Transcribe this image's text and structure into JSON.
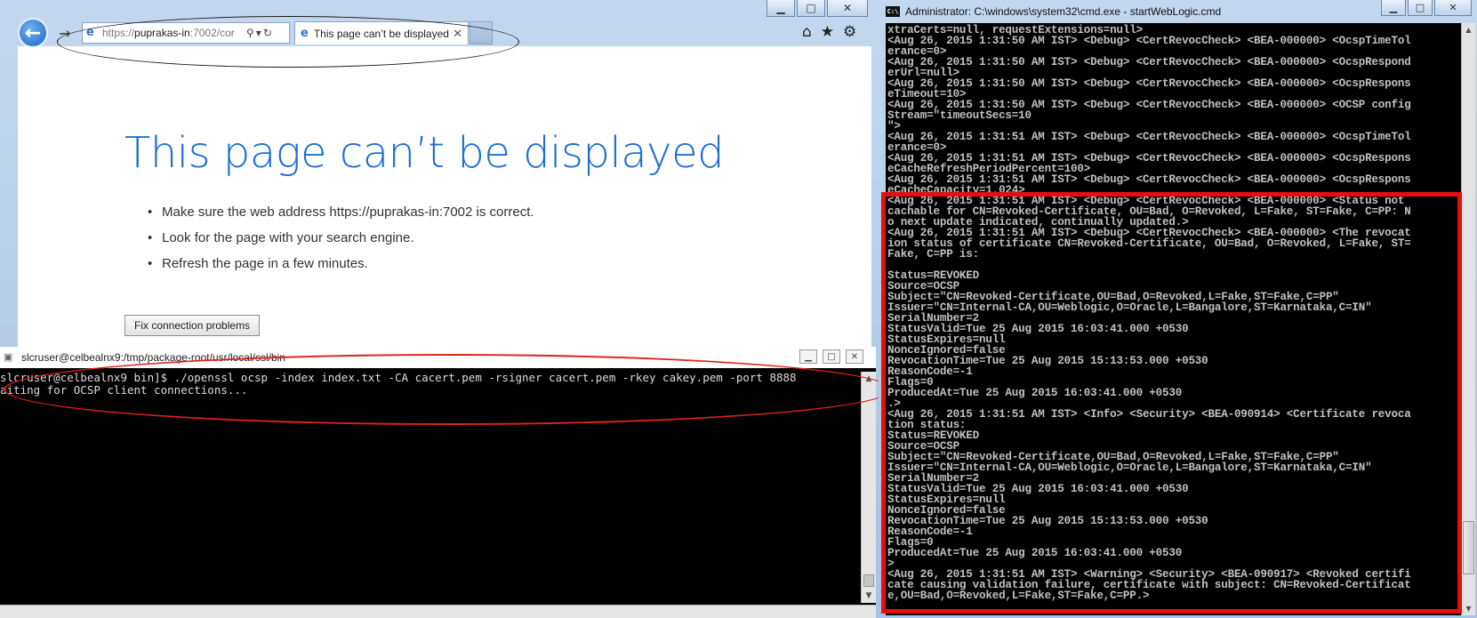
{
  "browser": {
    "controls": {
      "minimize": "▁",
      "maximize": "□",
      "close": "✕"
    },
    "back_icon": "←",
    "forward_icon": "→",
    "address": {
      "url_host": "puprakas-in",
      "url_prefix": "https://",
      "url_suffix": ":7002/cor"
    },
    "tab": {
      "title": "This page can’t be displayed",
      "close": "✕"
    },
    "tools": {
      "home": "⌂",
      "favorites": "★",
      "settings": "⚙"
    },
    "error": {
      "title": "This page can’t be displayed",
      "tips": [
        "Make sure the web address https://puprakas-in:7002 is correct.",
        "Look for the page with your search engine.",
        "Refresh the page in a few minutes."
      ],
      "button": "Fix connection problems"
    }
  },
  "terminal": {
    "title": "slcruser@celbealnx9:/tmp/package-root/usr/local/ssl/bin",
    "lines": [
      "slcruser@celbealnx9 bin]$ ./openssl ocsp -index index.txt -CA cacert.pem -rsigner cacert.pem -rkey cakey.pem -port 8888",
      "aiting for OCSP client connections..."
    ]
  },
  "cmd": {
    "title": "Administrator: C:\\windows\\system32\\cmd.exe - startWebLogic.cmd",
    "lines": [
      "xtraCerts=null, requestExtensions=null>",
      "<Aug 26, 2015 1:31:50 AM IST> <Debug> <CertRevocCheck> <BEA-000000> <OcspTimeTol",
      "erance=0>",
      "<Aug 26, 2015 1:31:50 AM IST> <Debug> <CertRevocCheck> <BEA-000000> <OcspRespond",
      "erUrl=null>",
      "<Aug 26, 2015 1:31:50 AM IST> <Debug> <CertRevocCheck> <BEA-000000> <OcspRespons",
      "eTimeout=10>",
      "<Aug 26, 2015 1:31:50 AM IST> <Debug> <CertRevocCheck> <BEA-000000> <OCSP config",
      "Stream=\"timeoutSecs=10",
      "\">",
      "<Aug 26, 2015 1:31:51 AM IST> <Debug> <CertRevocCheck> <BEA-000000> <OcspTimeTol",
      "erance=0>",
      "<Aug 26, 2015 1:31:51 AM IST> <Debug> <CertRevocCheck> <BEA-000000> <OcspRespons",
      "eCacheRefreshPeriodPercent=100>",
      "<Aug 26, 2015 1:31:51 AM IST> <Debug> <CertRevocCheck> <BEA-000000> <OcspRespons",
      "eCacheCapacity=1,024>",
      "<Aug 26, 2015 1:31:51 AM IST> <Debug> <CertRevocCheck> <BEA-000000> <Status not",
      "cachable for CN=Revoked-Certificate, OU=Bad, O=Revoked, L=Fake, ST=Fake, C=PP: N",
      "o next update indicated, continually updated.>",
      "<Aug 26, 2015 1:31:51 AM IST> <Debug> <CertRevocCheck> <BEA-000000> <The revocat",
      "ion status of certificate CN=Revoked-Certificate, OU=Bad, O=Revoked, L=Fake, ST=",
      "Fake, C=PP is:",
      "",
      "Status=REVOKED",
      "Source=OCSP",
      "Subject=\"CN=Revoked-Certificate,OU=Bad,O=Revoked,L=Fake,ST=Fake,C=PP\"",
      "Issuer=\"CN=Internal-CA,OU=Weblogic,O=Oracle,L=Bangalore,ST=Karnataka,C=IN\"",
      "SerialNumber=2",
      "StatusValid=Tue 25 Aug 2015 16:03:41.000 +0530",
      "StatusExpires=null",
      "NonceIgnored=false",
      "RevocationTime=Tue 25 Aug 2015 15:13:53.000 +0530",
      "ReasonCode=-1",
      "Flags=0",
      "ProducedAt=Tue 25 Aug 2015 16:03:41.000 +0530",
      ".>",
      "<Aug 26, 2015 1:31:51 AM IST> <Info> <Security> <BEA-090914> <Certificate revoca",
      "tion status:",
      "Status=REVOKED",
      "Source=OCSP",
      "Subject=\"CN=Revoked-Certificate,OU=Bad,O=Revoked,L=Fake,ST=Fake,C=PP\"",
      "Issuer=\"CN=Internal-CA,OU=Weblogic,O=Oracle,L=Bangalore,ST=Karnataka,C=IN\"",
      "SerialNumber=2",
      "StatusValid=Tue 25 Aug 2015 16:03:41.000 +0530",
      "StatusExpires=null",
      "NonceIgnored=false",
      "RevocationTime=Tue 25 Aug 2015 15:13:53.000 +0530",
      "ReasonCode=-1",
      "Flags=0",
      "ProducedAt=Tue 25 Aug 2015 16:03:41.000 +0530",
      ">",
      "<Aug 26, 2015 1:31:51 AM IST> <Warning> <Security> <BEA-090917> <Revoked certifi",
      "cate causing validation failure, certificate with subject: CN=Revoked-Certificat",
      "e,OU=Bad,O=Revoked,L=Fake,ST=Fake,C=PP.>"
    ]
  },
  "colors": {
    "annotation_red": "#e40f0f",
    "ie_blue": "#1e6fd0",
    "terminal_bg": "#000000"
  }
}
